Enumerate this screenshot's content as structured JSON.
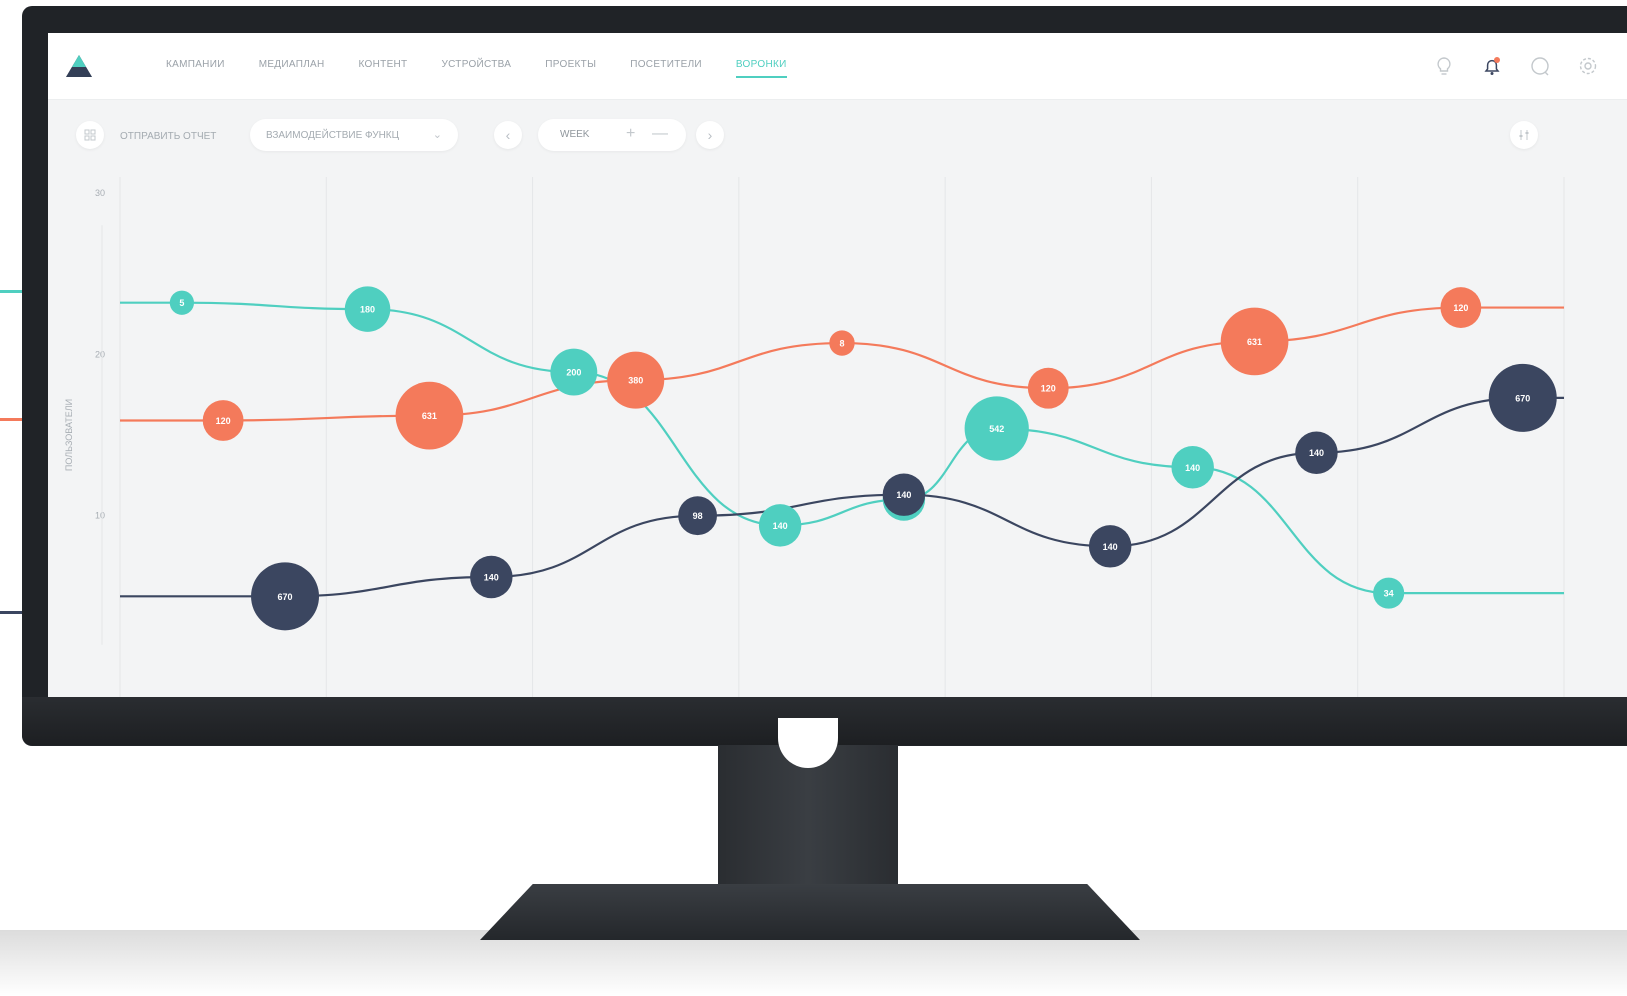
{
  "colors": {
    "teal": "#4fcfc0",
    "orange": "#f47a5b",
    "navy": "#3b4660"
  },
  "nav": {
    "items": [
      {
        "label": "Кампании"
      },
      {
        "label": "Медиаплан"
      },
      {
        "label": "Контент"
      },
      {
        "label": "Устройства"
      },
      {
        "label": "Проекты"
      },
      {
        "label": "Посетители"
      },
      {
        "label": "Воронки",
        "active": true
      }
    ]
  },
  "icons": {
    "logo": "logo-icon",
    "bulb": "lightbulb-icon",
    "bell": "bell-icon",
    "chat": "chat-icon",
    "settings": "gear-icon",
    "grid": "grid-icon",
    "prev": "chevron-left-icon",
    "next": "chevron-right-icon",
    "chart_settings": "sliders-icon",
    "dropdown": "chevron-down-icon"
  },
  "toolbar": {
    "send_report": "ОТПРАВИТЬ ОТЧЕТ",
    "dropdown_value": "ВЗАИМОДЕЙСТВИЕ ФУНКЦ",
    "period": "WEEK",
    "plus": "+",
    "minus": "—"
  },
  "chart_data": {
    "type": "line",
    "ylabel": "ПОЛЬЗОВАТЕЛИ",
    "yticks": [
      10,
      20,
      30
    ],
    "ylim": [
      0,
      30
    ],
    "grid": true,
    "series": [
      {
        "color_key": "teal",
        "points": [
          {
            "x": 0.3,
            "y": 23.2,
            "label": "5"
          },
          {
            "x": 1.2,
            "y": 22.8,
            "label": "180"
          },
          {
            "x": 2.2,
            "y": 18.9,
            "label": "200"
          },
          {
            "x": 3.2,
            "y": 9.4,
            "label": "140"
          },
          {
            "x": 3.8,
            "y": 11.0,
            "label": "140"
          },
          {
            "x": 4.25,
            "y": 15.4,
            "label": "542"
          },
          {
            "x": 5.2,
            "y": 13.0,
            "label": "140"
          },
          {
            "x": 6.15,
            "y": 5.2,
            "label": "34"
          }
        ]
      },
      {
        "color_key": "orange",
        "points": [
          {
            "x": 0.5,
            "y": 15.9,
            "label": "120"
          },
          {
            "x": 1.5,
            "y": 16.2,
            "label": "631"
          },
          {
            "x": 2.5,
            "y": 18.4,
            "label": "380"
          },
          {
            "x": 3.5,
            "y": 20.7,
            "label": "8"
          },
          {
            "x": 4.5,
            "y": 17.9,
            "label": "120"
          },
          {
            "x": 5.5,
            "y": 20.8,
            "label": "631"
          },
          {
            "x": 6.5,
            "y": 22.9,
            "label": "120"
          }
        ]
      },
      {
        "color_key": "navy",
        "points": [
          {
            "x": 0.8,
            "y": 5.0,
            "label": "670"
          },
          {
            "x": 1.8,
            "y": 6.2,
            "label": "140"
          },
          {
            "x": 2.8,
            "y": 10.0,
            "label": "98"
          },
          {
            "x": 3.8,
            "y": 11.3,
            "label": "140"
          },
          {
            "x": 4.8,
            "y": 8.1,
            "label": "140"
          },
          {
            "x": 5.8,
            "y": 13.9,
            "label": "140"
          },
          {
            "x": 6.8,
            "y": 17.3,
            "label": "670"
          }
        ]
      }
    ]
  }
}
